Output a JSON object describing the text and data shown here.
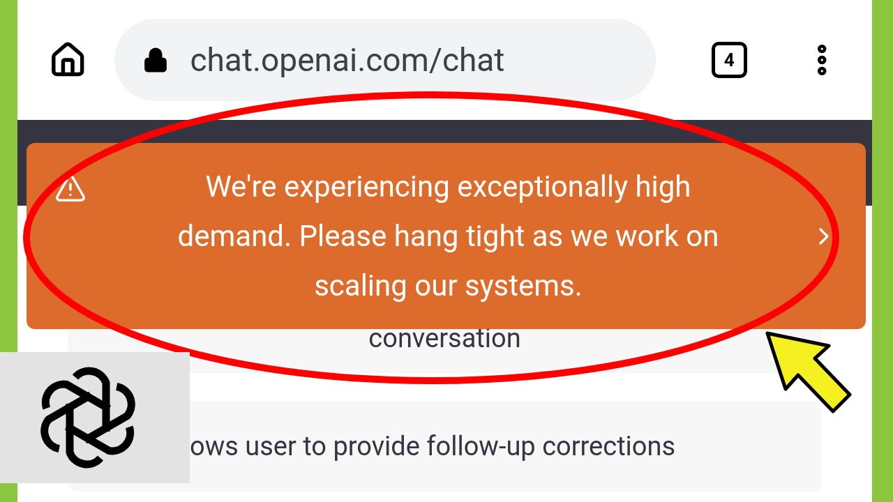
{
  "address_bar": {
    "url": "chat.openai.com/chat"
  },
  "tab_count": "4",
  "banner": {
    "message": "We're experiencing exceptionally high demand. Please hang tight as we work on scaling our systems."
  },
  "cards": [
    {
      "text": "conversation"
    },
    {
      "text": "ows user to provide follow-up corrections"
    }
  ]
}
